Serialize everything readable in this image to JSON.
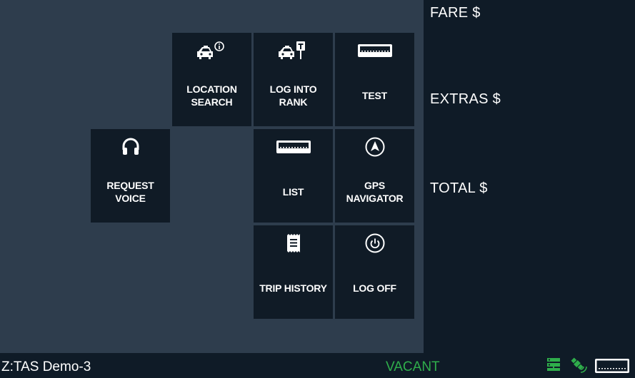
{
  "tiles": [
    {
      "id": "location-search",
      "label": "LOCATION\nSEARCH",
      "icon": "taxi-info-icon"
    },
    {
      "id": "log-into-rank",
      "label": "LOG INTO\nRANK",
      "icon": "taxi-rank-icon"
    },
    {
      "id": "test",
      "label": "TEST",
      "icon": "meter-icon"
    },
    {
      "id": "request-voice",
      "label": "REQUEST\nVOICE",
      "icon": "headset-icon"
    },
    {
      "id": "list",
      "label": "LIST",
      "icon": "meter-icon"
    },
    {
      "id": "gps-navigator",
      "label": "GPS\nNAVIGATOR",
      "icon": "navigation-arrow-icon"
    },
    {
      "id": "trip-history",
      "label": "TRIP HISTORY",
      "icon": "receipt-icon"
    },
    {
      "id": "log-off",
      "label": "LOG OFF",
      "icon": "power-icon"
    }
  ],
  "fare_panel": {
    "fare_label": "FARE $",
    "extras_label": "EXTRAS $",
    "total_label": "TOTAL $"
  },
  "status_bar": {
    "device_name": "Z:TAS Demo-3",
    "status": "VACANT",
    "status_color": "#2fae4b",
    "icons": [
      "server-icon",
      "satellite-icon",
      "meter-icon"
    ]
  }
}
